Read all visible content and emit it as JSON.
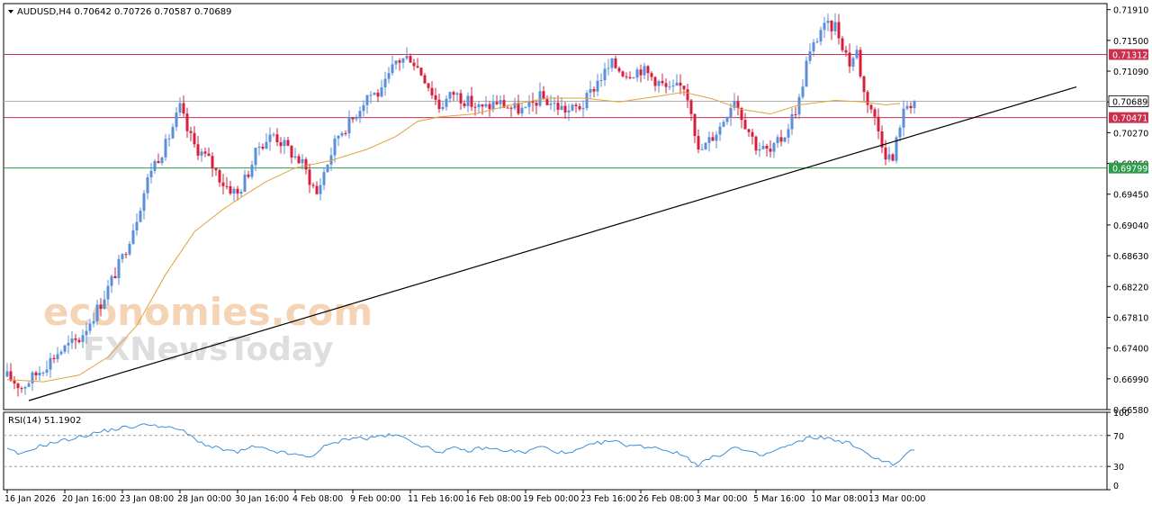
{
  "header": {
    "symbol_line": "AUDUSD,H4  0.70642 0.70726 0.70587 0.70689"
  },
  "watermark": {
    "line1": "economies.com",
    "line2": "FXNewsToday"
  },
  "colors": {
    "background": "#ffffff",
    "grid": "#c0c0c0",
    "bull": "#5b8fd9",
    "bear": "#d61f3d",
    "ma": "#e0a33a",
    "resistance": "#c8324f",
    "support": "#2c9c4a",
    "trendline": "#000000",
    "rsi": "#3f8fd6",
    "current_price_bg": "#ffffff"
  },
  "chart_data": [
    {
      "type": "candlestick",
      "title": "AUDUSD,H4",
      "ohlc_header": {
        "open": 0.70642,
        "high": 0.70726,
        "low": 0.70587,
        "close": 0.70689
      },
      "y_ticks": [
        0.7191,
        0.715,
        0.7109,
        0.7068,
        0.7027,
        0.6986,
        0.6945,
        0.6904,
        0.6863,
        0.6822,
        0.6781,
        0.674,
        0.6699,
        0.6658
      ],
      "ylim": [
        0.6658,
        0.7199
      ],
      "x_tick_labels": [
        "16 Jan 2026",
        "20 Jan 16:00",
        "23 Jan 08:00",
        "28 Jan 00:00",
        "30 Jan 16:00",
        "4 Feb 08:00",
        "9 Feb 00:00",
        "11 Feb 16:00",
        "16 Feb 08:00",
        "19 Feb 00:00",
        "23 Feb 16:00",
        "26 Feb 08:00",
        "3 Mar 00:00",
        "5 Mar 16:00",
        "10 Mar 08:00",
        "13 Mar 00:00"
      ],
      "x_tick_bar_index": [
        0,
        16,
        32,
        48,
        64,
        80,
        96,
        112,
        128,
        144,
        160,
        176,
        192,
        208,
        224,
        240
      ],
      "price_levels": [
        {
          "label": "0.71312",
          "value": 0.71312,
          "kind": "resistance"
        },
        {
          "label": "0.70471",
          "value": 0.70471,
          "kind": "resistance"
        },
        {
          "label": "0.69799",
          "value": 0.69799,
          "kind": "support"
        }
      ],
      "current_price": {
        "label": "0.70689",
        "value": 0.70689
      },
      "trendline": {
        "start": {
          "bar": 6,
          "price": 0.667
        },
        "end": {
          "bar": 297,
          "price": 0.7088
        }
      },
      "moving_average": [
        [
          0,
          0.6698
        ],
        [
          10,
          0.6695
        ],
        [
          20,
          0.6704
        ],
        [
          28,
          0.6728
        ],
        [
          36,
          0.677
        ],
        [
          44,
          0.6838
        ],
        [
          52,
          0.6895
        ],
        [
          60,
          0.6925
        ],
        [
          66,
          0.6944
        ],
        [
          72,
          0.6962
        ],
        [
          80,
          0.698
        ],
        [
          90,
          0.699
        ],
        [
          100,
          0.7005
        ],
        [
          108,
          0.7022
        ],
        [
          114,
          0.7042
        ],
        [
          120,
          0.7048
        ],
        [
          130,
          0.7052
        ],
        [
          140,
          0.7064
        ],
        [
          150,
          0.7073
        ],
        [
          160,
          0.7073
        ],
        [
          170,
          0.7068
        ],
        [
          180,
          0.7075
        ],
        [
          188,
          0.7081
        ],
        [
          196,
          0.7072
        ],
        [
          204,
          0.7058
        ],
        [
          212,
          0.7052
        ],
        [
          220,
          0.7064
        ],
        [
          230,
          0.707
        ],
        [
          238,
          0.7068
        ],
        [
          244,
          0.7064
        ],
        [
          248,
          0.7066
        ]
      ],
      "price_path": [
        [
          0,
          0.6702
        ],
        [
          4,
          0.6688
        ],
        [
          8,
          0.6705
        ],
        [
          14,
          0.6734
        ],
        [
          20,
          0.6752
        ],
        [
          26,
          0.68
        ],
        [
          32,
          0.686
        ],
        [
          36,
          0.6915
        ],
        [
          40,
          0.698
        ],
        [
          44,
          0.701
        ],
        [
          48,
          0.706
        ],
        [
          50,
          0.703
        ],
        [
          52,
          0.701
        ],
        [
          56,
          0.699
        ],
        [
          60,
          0.696
        ],
        [
          64,
          0.6945
        ],
        [
          67,
          0.6975
        ],
        [
          70,
          0.701
        ],
        [
          74,
          0.7025
        ],
        [
          78,
          0.7005
        ],
        [
          82,
          0.6985
        ],
        [
          86,
          0.6945
        ],
        [
          88,
          0.6975
        ],
        [
          92,
          0.7025
        ],
        [
          96,
          0.7045
        ],
        [
          100,
          0.7078
        ],
        [
          104,
          0.708
        ],
        [
          108,
          0.7122
        ],
        [
          112,
          0.7128
        ],
        [
          116,
          0.71
        ],
        [
          120,
          0.7062
        ],
        [
          124,
          0.708
        ],
        [
          128,
          0.7068
        ],
        [
          132,
          0.7058
        ],
        [
          136,
          0.7068
        ],
        [
          140,
          0.706
        ],
        [
          144,
          0.7056
        ],
        [
          148,
          0.7074
        ],
        [
          152,
          0.7064
        ],
        [
          156,
          0.7056
        ],
        [
          160,
          0.7064
        ],
        [
          164,
          0.7096
        ],
        [
          168,
          0.7118
        ],
        [
          172,
          0.7106
        ],
        [
          176,
          0.7112
        ],
        [
          180,
          0.7098
        ],
        [
          184,
          0.7082
        ],
        [
          188,
          0.709
        ],
        [
          190,
          0.706
        ],
        [
          192,
          0.7
        ],
        [
          194,
          0.701
        ],
        [
          198,
          0.7035
        ],
        [
          202,
          0.7075
        ],
        [
          204,
          0.705
        ],
        [
          208,
          0.701
        ],
        [
          212,
          0.7
        ],
        [
          216,
          0.7025
        ],
        [
          220,
          0.707
        ],
        [
          222,
          0.712
        ],
        [
          226,
          0.7165
        ],
        [
          230,
          0.717
        ],
        [
          234,
          0.712
        ],
        [
          236,
          0.7135
        ],
        [
          238,
          0.708
        ],
        [
          240,
          0.706
        ],
        [
          242,
          0.703
        ],
        [
          244,
          0.7
        ],
        [
          246,
          0.699
        ],
        [
          248,
          0.704
        ],
        [
          250,
          0.7065
        ],
        [
          252,
          0.7069
        ]
      ]
    },
    {
      "type": "line",
      "title": "RSI(14) 51.1902",
      "y_ticks": [
        100,
        70,
        30,
        0
      ],
      "levels": [
        70,
        30
      ],
      "ylim": [
        0,
        100
      ],
      "values": [
        [
          0,
          52
        ],
        [
          4,
          45
        ],
        [
          8,
          55
        ],
        [
          14,
          62
        ],
        [
          20,
          68
        ],
        [
          26,
          75
        ],
        [
          32,
          80
        ],
        [
          36,
          82
        ],
        [
          40,
          85
        ],
        [
          44,
          80
        ],
        [
          48,
          78
        ],
        [
          52,
          66
        ],
        [
          56,
          56
        ],
        [
          60,
          52
        ],
        [
          64,
          48
        ],
        [
          68,
          55
        ],
        [
          72,
          52
        ],
        [
          76,
          48
        ],
        [
          80,
          45
        ],
        [
          84,
          42
        ],
        [
          88,
          55
        ],
        [
          92,
          62
        ],
        [
          96,
          68
        ],
        [
          100,
          66
        ],
        [
          104,
          70
        ],
        [
          108,
          70
        ],
        [
          112,
          64
        ],
        [
          116,
          55
        ],
        [
          120,
          49
        ],
        [
          124,
          53
        ],
        [
          128,
          50
        ],
        [
          132,
          54
        ],
        [
          136,
          52
        ],
        [
          140,
          50
        ],
        [
          144,
          48
        ],
        [
          148,
          56
        ],
        [
          152,
          50
        ],
        [
          156,
          46
        ],
        [
          160,
          54
        ],
        [
          164,
          60
        ],
        [
          168,
          63
        ],
        [
          172,
          58
        ],
        [
          176,
          56
        ],
        [
          180,
          55
        ],
        [
          184,
          50
        ],
        [
          188,
          44
        ],
        [
          190,
          38
        ],
        [
          192,
          32
        ],
        [
          194,
          38
        ],
        [
          198,
          45
        ],
        [
          202,
          55
        ],
        [
          206,
          48
        ],
        [
          210,
          44
        ],
        [
          214,
          52
        ],
        [
          218,
          58
        ],
        [
          222,
          66
        ],
        [
          226,
          68
        ],
        [
          230,
          64
        ],
        [
          234,
          60
        ],
        [
          238,
          48
        ],
        [
          242,
          40
        ],
        [
          246,
          33
        ],
        [
          248,
          36
        ],
        [
          250,
          48
        ],
        [
          252,
          51.19
        ]
      ]
    }
  ]
}
